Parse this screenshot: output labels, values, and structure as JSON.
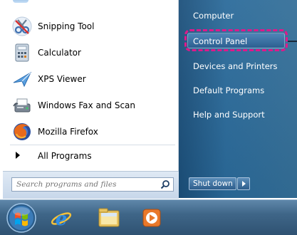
{
  "programs": [
    {
      "label": "Snipping Tool",
      "icon": "scissors-icon"
    },
    {
      "label": "Calculator",
      "icon": "calculator-icon"
    },
    {
      "label": "XPS Viewer",
      "icon": "paper-plane-icon"
    },
    {
      "label": "Windows Fax and Scan",
      "icon": "fax-icon"
    },
    {
      "label": "Mozilla Firefox",
      "icon": "firefox-icon"
    }
  ],
  "all_programs": {
    "label": "All Programs",
    "icon": "arrow-right-icon"
  },
  "search": {
    "placeholder": "Search programs and files",
    "icon": "magnifier-icon"
  },
  "places": [
    {
      "label": "Computer"
    },
    {
      "label": "Control Panel"
    },
    {
      "label": "Devices and Printers"
    },
    {
      "label": "Default Programs"
    },
    {
      "label": "Help and Support"
    }
  ],
  "shutdown": {
    "label": "Shut down",
    "arrow_icon": "arrow-right-icon"
  },
  "taskbar": {
    "items": [
      {
        "icon": "windows-start-orb-icon"
      },
      {
        "icon": "internet-explorer-icon"
      },
      {
        "icon": "file-explorer-icon"
      },
      {
        "icon": "media-player-icon"
      }
    ]
  },
  "colors": {
    "highlight": "#e0188a",
    "right_pane": "#2a6a9a",
    "taskbar": "#3f6688"
  }
}
